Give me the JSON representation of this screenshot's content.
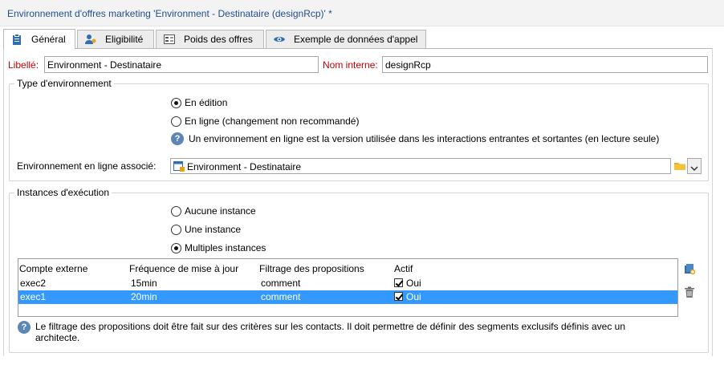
{
  "window": {
    "title": "Environnement d'offres marketing 'Environment - Destinataire (designRcp)' *"
  },
  "tabs": [
    {
      "label": "Général",
      "icon": "clipboard-icon"
    },
    {
      "label": "Eligibilité",
      "icon": "users-icon"
    },
    {
      "label": "Poids des offres",
      "icon": "weights-icon"
    },
    {
      "label": "Exemple de données d'appel",
      "icon": "eye-icon"
    }
  ],
  "form": {
    "libelle_label": "Libellé:",
    "libelle_value": "Environment - Destinataire",
    "nom_interne_label": "Nom interne:",
    "nom_interne_value": "designRcp"
  },
  "type_env": {
    "title": "Type d'environnement",
    "opt_edition": "En édition",
    "opt_ligne": "En ligne (changement non recommandé)",
    "info": "Un environnement en ligne est la version utilisée dans les interactions entrantes et sortantes (en lecture seule)",
    "assoc_label": "Environnement en ligne associé:",
    "assoc_value": "Environment - Destinataire"
  },
  "instances": {
    "title": "Instances d'exécution",
    "opt_aucune": "Aucune instance",
    "opt_une": "Une instance",
    "opt_multiples": "Multiples instances",
    "columns": [
      "Compte externe",
      "Fréquence de mise à jour",
      "Filtrage des propositions",
      "Actif"
    ],
    "rows": [
      {
        "compte": "exec2",
        "frequence": "15min",
        "filtrage": "comment",
        "actif": "Oui"
      },
      {
        "compte": "exec1",
        "frequence": "20min",
        "filtrage": "comment",
        "actif": "Oui"
      }
    ],
    "info": "Le filtrage des propositions doit être fait sur des critères sur les contacts.  Il doit permettre de définir des segments exclusifs définis avec un architecte."
  },
  "colors": {
    "accent": "#3399ff",
    "required_label": "#c00000",
    "title_text": "#1f4e8c"
  }
}
